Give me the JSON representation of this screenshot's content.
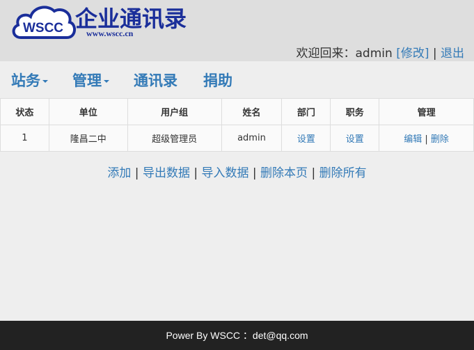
{
  "header": {
    "logo": {
      "badge": "WSCC",
      "title": "企业通讯录",
      "url": "www.wscc.cn"
    },
    "welcome_prefix": "欢迎回来：",
    "username": "admin",
    "edit_link": "[修改]",
    "separator": " | ",
    "logout_link": "退出"
  },
  "nav": {
    "items": [
      {
        "label": "站务",
        "dropdown": true
      },
      {
        "label": "管理",
        "dropdown": true
      },
      {
        "label": "通讯录",
        "dropdown": false
      },
      {
        "label": "捐助",
        "dropdown": false
      }
    ]
  },
  "table": {
    "columns": [
      "状态",
      "单位",
      "用户组",
      "姓名",
      "部门",
      "职务",
      "管理"
    ],
    "rows": [
      {
        "status": "1",
        "unit": "隆昌二中",
        "group": "超级管理员",
        "name": "admin",
        "department": "设置",
        "position": "设置",
        "edit": "编辑",
        "sep": " | ",
        "delete": "删除"
      }
    ]
  },
  "actions": {
    "add": "添加",
    "export": "导出数据",
    "import": "导入数据",
    "delete_page": "删除本页",
    "delete_all": "删除所有",
    "sep": " | "
  },
  "footer": {
    "text": "Power By WSCC ：det@qq.com"
  },
  "colors": {
    "link": "#337ab7",
    "logo_blue": "#1a2e9a",
    "footer_bg": "#222222"
  }
}
